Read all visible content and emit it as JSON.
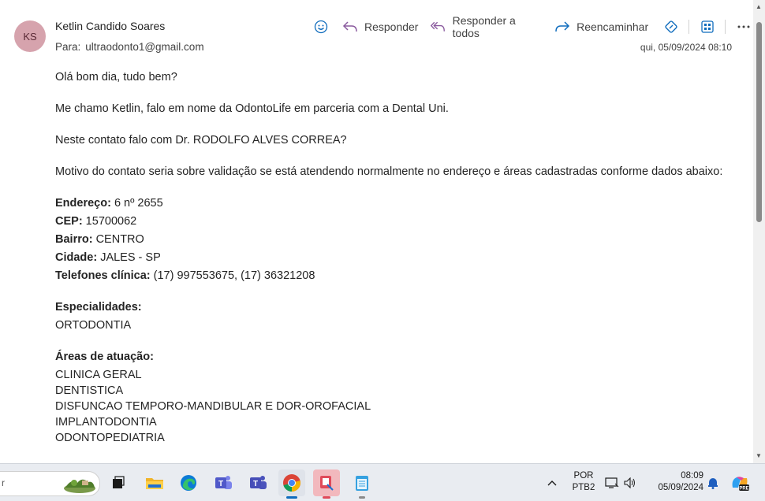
{
  "header": {
    "avatar_initials": "KS",
    "sender_name": "Ketlin Candido Soares",
    "to_label": "Para:",
    "to_address": "ultraodonto1@gmail.com",
    "date": "qui, 05/09/2024 08:10",
    "actions": {
      "reply": "Responder",
      "reply_all": "Responder a todos",
      "forward": "Reencaminhar"
    }
  },
  "body": {
    "greeting": "Olá bom dia, tudo bem?",
    "intro": "Me chamo Ketlin, falo em nome da OdontoLife em parceria com a Dental Uni.",
    "question": "Neste contato falo com Dr. RODOLFO ALVES CORREA?",
    "motive": "Motivo do contato seria sobre validação se está atendendo normalmente no endereço e áreas cadastradas conforme dados abaixo:",
    "address": [
      {
        "label": "Endereço:",
        "value": " 6 nº 2655"
      },
      {
        "label": "CEP:",
        "value": " 15700062"
      },
      {
        "label": "Bairro:",
        "value": " CENTRO"
      },
      {
        "label": "Cidade:",
        "value": " JALES - SP"
      },
      {
        "label": "Telefones clínica:",
        "value": " (17) 997553675, (17) 36321208"
      }
    ],
    "specialties_label": "Especialidades:",
    "specialties": [
      "ORTODONTIA"
    ],
    "areas_label": "Áreas de atuação:",
    "areas": [
      "CLINICA GERAL",
      "DENTISTICA",
      "DISFUNCAO TEMPORO-MANDIBULAR E DOR-OROFACIAL",
      "IMPLANTODONTIA",
      "ODONTOPEDIATRIA"
    ]
  },
  "taskbar": {
    "search_text": "r",
    "lang_top": "POR",
    "lang_bottom": "PTB2",
    "time": "08:09",
    "date": "05/09/2024"
  },
  "colors": {
    "accent": "#0f6cbd",
    "avatar_bg": "#d6a3ad"
  }
}
